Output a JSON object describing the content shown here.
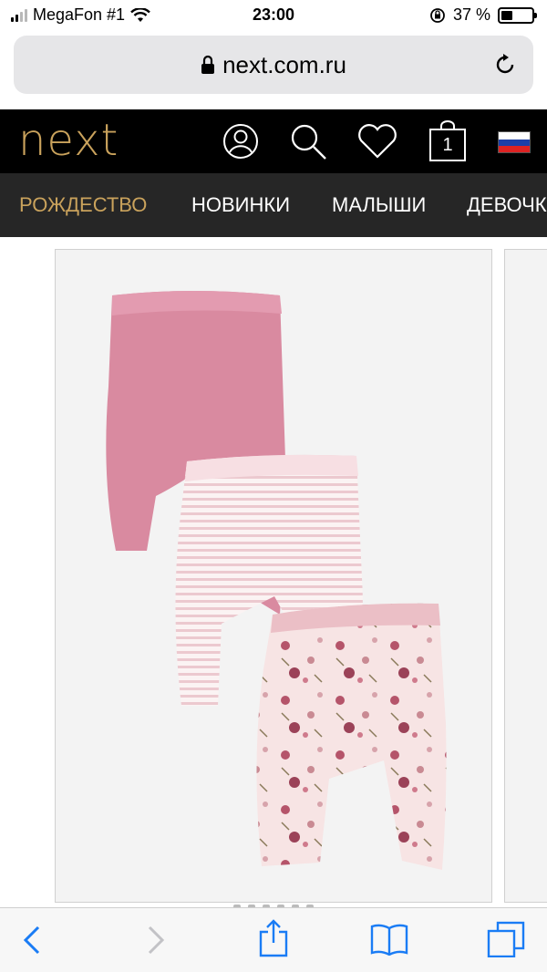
{
  "status_bar": {
    "carrier": "MegaFon #1",
    "time": "23:00",
    "battery_percent": "37 %",
    "battery_level": 0.37
  },
  "browser": {
    "url": "next.com.ru",
    "lock_icon": "lock-icon",
    "reload_icon": "reload-icon"
  },
  "header": {
    "logo": "next",
    "logo_color": "#c9a25c",
    "cart_count": "1",
    "icons": [
      "account-icon",
      "search-icon",
      "heart-icon",
      "bag-icon",
      "russia-flag-icon"
    ]
  },
  "nav": {
    "items": [
      {
        "label": "РОЖДЕСТВО",
        "active": true
      },
      {
        "label": "НОВИНКИ",
        "active": false
      },
      {
        "label": "МАЛЫШИ",
        "active": false
      },
      {
        "label": "ДЕВОЧКИ",
        "active": false
      }
    ]
  },
  "toolbar": {
    "icons": [
      "back-icon",
      "forward-icon",
      "share-icon",
      "bookmarks-icon",
      "tabs-icon"
    ]
  },
  "colors": {
    "accent": "#c9a25c",
    "header_bg": "#000000",
    "nav_bg": "#262626",
    "ios_blue": "#1a7cf5"
  }
}
